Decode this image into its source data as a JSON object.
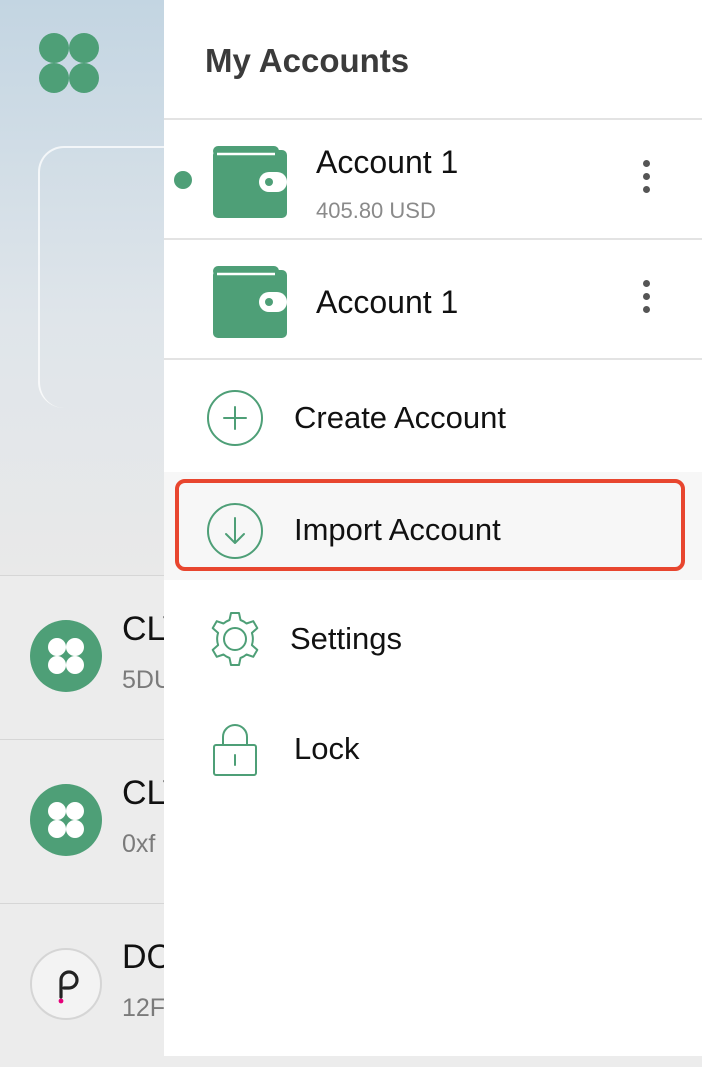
{
  "drawer": {
    "title": "My Accounts",
    "accounts": [
      {
        "name": "Account 1",
        "balance": "405.80 USD",
        "active": true
      },
      {
        "name": "Account 1",
        "balance": "",
        "active": false
      }
    ],
    "menu": [
      {
        "label": "Create Account",
        "icon": "plus-circle-icon"
      },
      {
        "label": "Import Account",
        "icon": "download-arrow-icon",
        "highlighted": true
      },
      {
        "label": "Settings",
        "icon": "gear-icon"
      },
      {
        "label": "Lock",
        "icon": "lock-icon"
      }
    ]
  },
  "background": {
    "assets": [
      {
        "name": "CLV",
        "address": "5DU",
        "icon": "clover-icon"
      },
      {
        "name": "CLV",
        "address": "0xf",
        "icon": "clover-icon"
      },
      {
        "name": "DO",
        "address": "12F",
        "icon": "polkadot-icon"
      }
    ]
  },
  "colors": {
    "accent": "#4e9f77",
    "highlight_border": "#e8462f",
    "polkadot_dot": "#e6007a"
  }
}
